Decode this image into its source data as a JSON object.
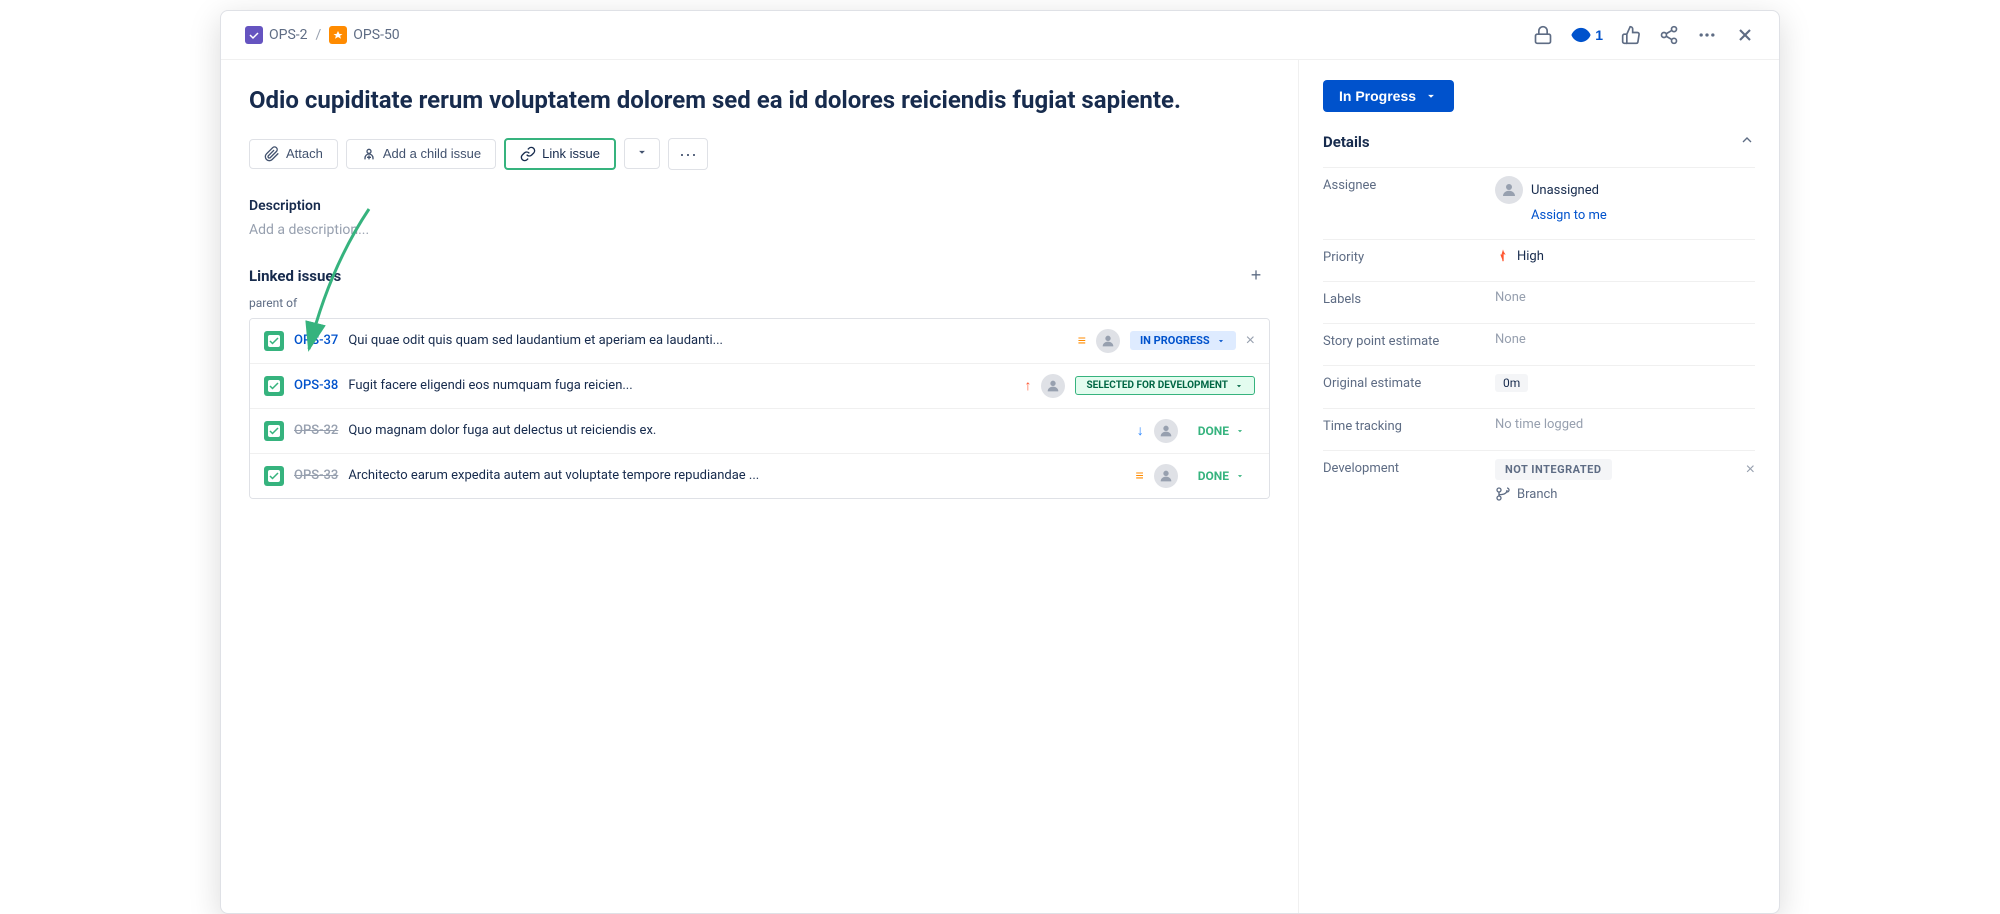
{
  "breadcrumb": {
    "ops2": "OPS-2",
    "ops50": "OPS-50"
  },
  "header_actions": {
    "watch_count": "1",
    "like_label": "like",
    "share_label": "share",
    "more_label": "more",
    "close_label": "close"
  },
  "issue": {
    "title": "Odio cupiditate rerum voluptatem dolorem sed ea id dolores reiciendis fugiat sapiente.",
    "status": "In Progress",
    "actions": {
      "attach": "Attach",
      "add_child": "Add a child issue",
      "link_issue": "Link issue",
      "more": "···"
    },
    "description_placeholder": "Add a description...",
    "linked_issues": {
      "title": "Linked issues",
      "parent_of_label": "parent of",
      "items": [
        {
          "key": "OPS-37",
          "summary": "Qui quae odit quis quam sed laudantium et aperiam ea laudanti...",
          "priority": "medium",
          "status": "IN PROGRESS",
          "status_class": "in-progress",
          "strikethrough": false
        },
        {
          "key": "OPS-38",
          "summary": "Fugit facere eligendi eos numquam fuga reicien...",
          "priority": "high",
          "status": "SELECTED FOR DEVELOPMENT",
          "status_class": "selected",
          "strikethrough": false
        },
        {
          "key": "OPS-32",
          "summary": "Quo magnam dolor fuga aut delectus ut reiciendis ex.",
          "priority": "low",
          "status": "DONE",
          "status_class": "done",
          "strikethrough": true
        },
        {
          "key": "OPS-33",
          "summary": "Architecto earum expedita autem aut voluptate tempore repudiandae ...",
          "priority": "medium",
          "status": "DONE",
          "status_class": "done",
          "strikethrough": true
        }
      ]
    }
  },
  "sidebar": {
    "status_button": "In Progress",
    "details_title": "Details",
    "assignee_label": "Assignee",
    "assignee_value": "Unassigned",
    "assign_to_me": "Assign to me",
    "priority_label": "Priority",
    "priority_value": "High",
    "labels_label": "Labels",
    "labels_value": "None",
    "story_points_label": "Story point estimate",
    "story_points_value": "None",
    "original_estimate_label": "Original estimate",
    "original_estimate_value": "0m",
    "time_tracking_label": "Time tracking",
    "time_tracking_value": "No time logged",
    "development_label": "Development",
    "not_integrated": "NOT INTEGRATED",
    "branch_label": "Branch"
  }
}
